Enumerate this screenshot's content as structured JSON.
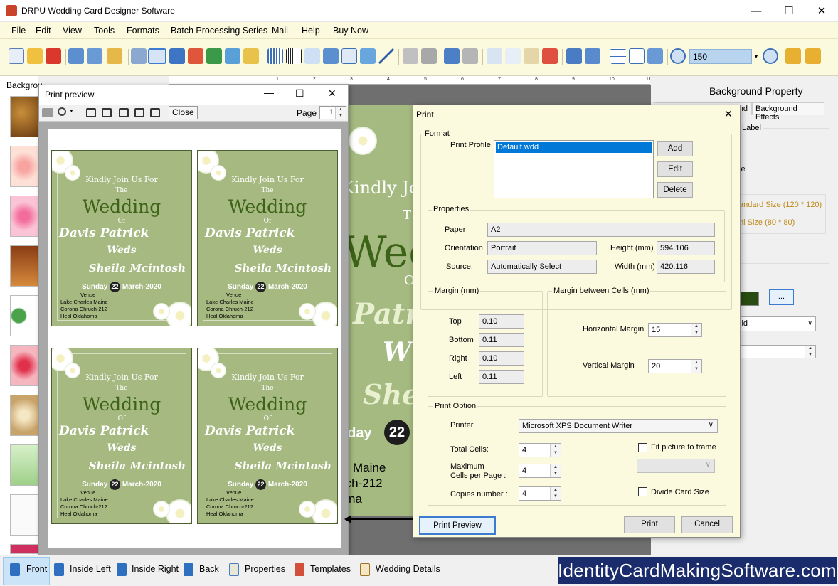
{
  "app": {
    "title": "DRPU Wedding Card Designer Software"
  },
  "menu": [
    "File",
    "Edit",
    "View",
    "Tools",
    "Formats",
    "Batch Processing Series",
    "Mail",
    "Help",
    "Buy Now"
  ],
  "toolbar": {
    "zoom_value": "150"
  },
  "left_panel": {
    "tab_label": "Backgrou"
  },
  "canvas": {
    "line_kindly": "Kindly Jo",
    "line_the": "T",
    "line_wedding": "Wedd",
    "line_of": "O",
    "line_patrick": "Patri",
    "line_weds": "W",
    "line_sheila": "She",
    "line_sunday": "nday",
    "line_day": "22",
    "line_maine": "Maine",
    "line_church": "rch-212",
    "line_okla": "na"
  },
  "right_panel": {
    "title": "Background Property",
    "tab_partial": "nd",
    "tab_effects": "Background Effects",
    "label_partial": "Label",
    "gle_partial": "le",
    "size_standard": "andard Size (120 * 120)",
    "size_mini": "ni Size (80 * 80)",
    "ellipsis_btn": "...",
    "lid_partial": "lid"
  },
  "print_preview": {
    "title": "Print preview",
    "close_label": "Close",
    "page_label": "Page",
    "page_value": "1",
    "card": {
      "kindly": "Kindly Join Us For",
      "the": "The",
      "wedding": "Wedding",
      "of": "Of",
      "groom": "Davis Patrick",
      "weds": "Weds",
      "bride": "Sheila Mcintosh",
      "date_pre": "Sunday",
      "date_day": "22",
      "date_post": "March-2020",
      "venue": "Venue",
      "venue1": "Lake Charles Maine",
      "venue2": "Corona Chruch-212",
      "venue3": "Heal Oklahoma"
    }
  },
  "print_dialog": {
    "title": "Print",
    "format_label": "Format",
    "profile_label": "Print Profile",
    "profile_item": "Default.wdd",
    "add": "Add",
    "edit": "Edit",
    "delete": "Delete",
    "properties_label": "Properties",
    "paper_label": "Paper",
    "paper_value": "A2",
    "orientation_label": "Orientation",
    "orientation_value": "Portrait",
    "height_label": "Height (mm)",
    "height_value": "594.106",
    "source_label": "Source:",
    "source_value": "Automatically Select",
    "width_label": "Width (mm)",
    "width_value": "420.116",
    "margin_label": "Margin (mm)",
    "top_label": "Top",
    "top_value": "0.10",
    "bottom_label": "Bottom",
    "bottom_value": "0.11",
    "right_label": "Right",
    "right_value": "0.10",
    "left_label": "Left",
    "left_value": "0.11",
    "cell_margin_label": "Margin between Cells (mm)",
    "hmargin_label": "Horizontal Margin",
    "hmargin_value": "15",
    "vmargin_label": "Vertical Margin",
    "vmargin_value": "20",
    "print_option_label": "Print Option",
    "printer_label": "Printer",
    "printer_value": "Microsoft XPS Document Writer",
    "total_cells_label": "Total Cells:",
    "total_cells_value": "4",
    "max_cells_label1": "Maximum",
    "max_cells_label2": "Cells per Page :",
    "max_cells_value": "4",
    "copies_label": "Copies number :",
    "copies_value": "4",
    "fit_label": "Fit picture to frame",
    "divide_label": "Divide Card Size",
    "preview_btn": "Print Preview",
    "print_btn": "Print",
    "cancel_btn": "Cancel"
  },
  "bottom_tabs": [
    "Front",
    "Inside Left",
    "Inside Right",
    "Back",
    "Properties",
    "Templates",
    "Wedding Details"
  ],
  "brand": "IdentityCardMakingSoftware.com",
  "ruler_labels": [
    "1",
    "2",
    "3",
    "4",
    "5",
    "6",
    "7",
    "8",
    "9",
    "10",
    "11"
  ]
}
